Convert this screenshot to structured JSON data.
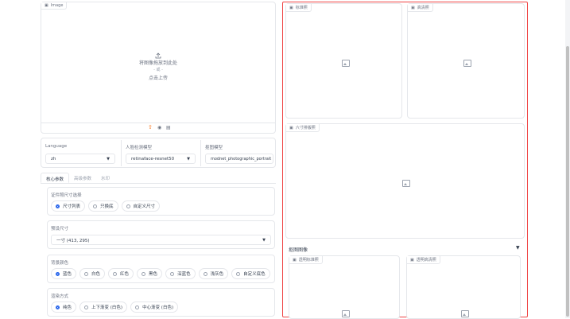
{
  "image_input": {
    "label": "Image",
    "drop_text": "将图像拖放到此处",
    "or_text": "- 或 -",
    "click_text": "点击上传"
  },
  "source_toolbar": [
    "upload-icon",
    "webcam-icon",
    "clipboard-icon"
  ],
  "settings": {
    "language": {
      "label": "Language",
      "value": "zh"
    },
    "face_model": {
      "label": "人脸检测模型",
      "value": "retinaface-resnet50"
    },
    "matting_model": {
      "label": "抠图模型",
      "value": "modnet_photographic_portrait"
    }
  },
  "tabs": [
    "核心参数",
    "高级参数",
    "水印"
  ],
  "size_mode": {
    "label": "证件照尺寸选择",
    "options": [
      "尺寸列表",
      "只换底",
      "自定义尺寸"
    ],
    "selected": 0
  },
  "preset_size": {
    "label": "预设尺寸",
    "value": "一寸 (413, 295)"
  },
  "bg_color": {
    "label": "背景颜色",
    "options": [
      "蓝色",
      "白色",
      "红色",
      "黑色",
      "深蓝色",
      "浅灰色",
      "自定义底色"
    ],
    "selected": 0
  },
  "render_mode": {
    "label": "渲染方式",
    "options": [
      "纯色",
      "上下渐变 (白色)",
      "中心渐变 (白色)"
    ],
    "selected": 0
  },
  "outputs": {
    "standard": "标准照",
    "hd": "高清照",
    "layout": "六寸排版照",
    "accordion_title": "抠图图像",
    "matting_standard": "透明标准照",
    "matting_hd": "透明高清照"
  },
  "colors": {
    "accent": "#f97316",
    "selected_border": "#ef4444",
    "radio": "#2563eb"
  }
}
